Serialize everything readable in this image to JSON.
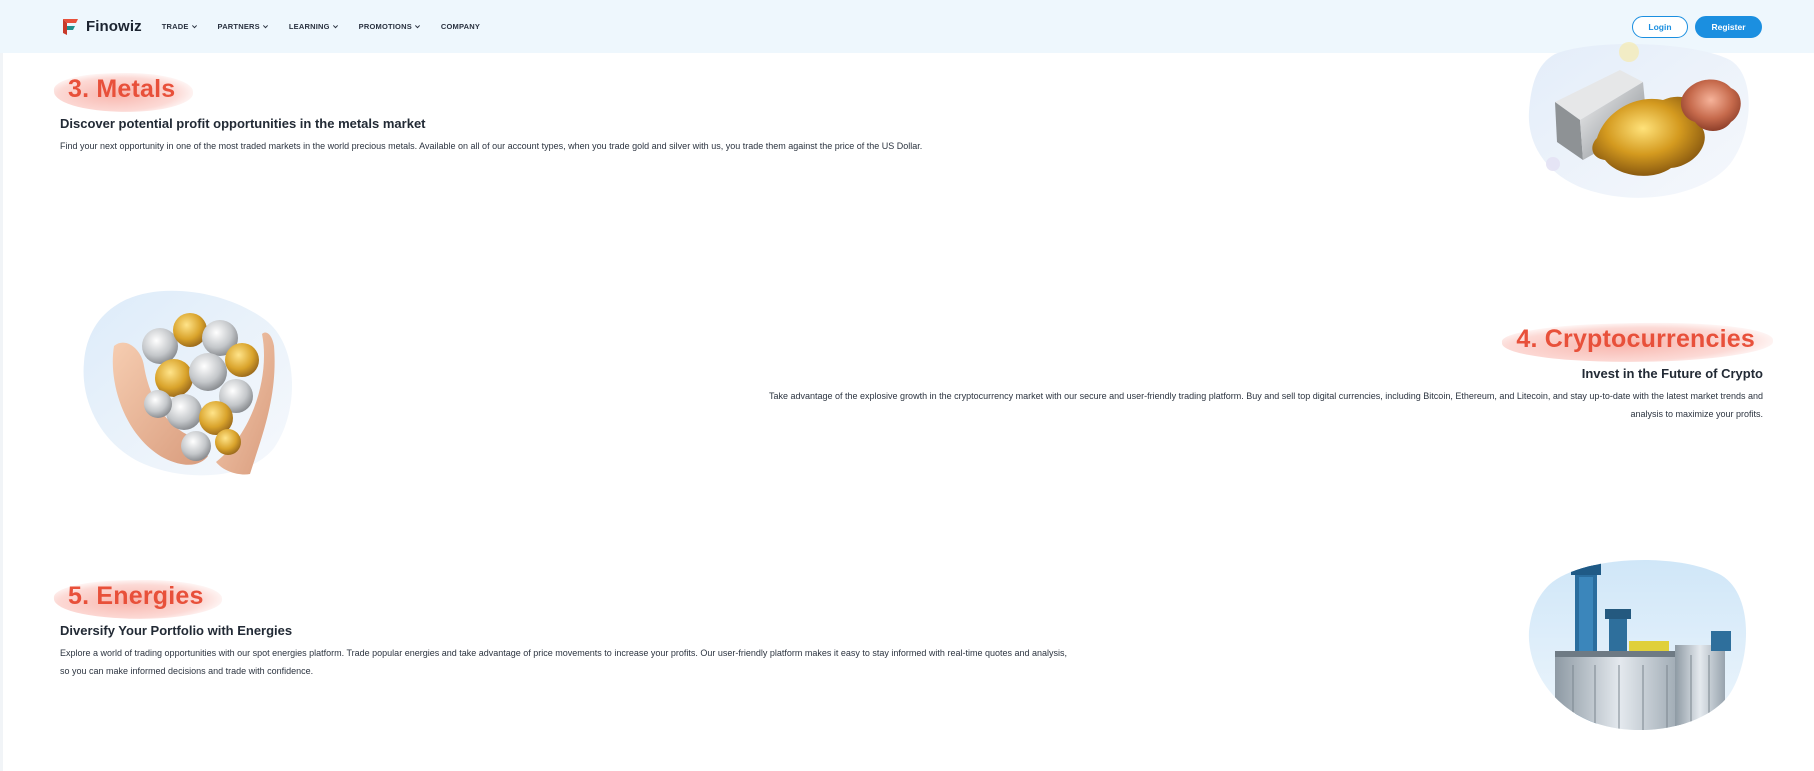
{
  "nav": {
    "brand": "Finowiz",
    "items": [
      {
        "label": "TRADE",
        "dropdown": true
      },
      {
        "label": "PARTNERS",
        "dropdown": true
      },
      {
        "label": "LEARNING",
        "dropdown": true
      },
      {
        "label": "PROMOTIONS",
        "dropdown": true
      },
      {
        "label": "COMPANY",
        "dropdown": false
      }
    ],
    "login_label": "Login",
    "register_label": "Register"
  },
  "sections": {
    "metals": {
      "heading": "3. Metals",
      "subheading": "Discover potential profit opportunities in the metals market",
      "description": "Find your next opportunity in one of the most traded markets in the world precious metals. Available on all of our account types, when you trade gold and silver with us, you trade them against the price of the US Dollar."
    },
    "crypto": {
      "heading": "4. Cryptocurrencies",
      "subheading": "Invest in the Future of Crypto",
      "description": "Take advantage of the explosive growth in the cryptocurrency market with our secure and user-friendly trading platform. Buy and sell top digital currencies, including Bitcoin, Ethereum, and Litecoin, and stay up-to-date with the latest market trends and analysis to maximize your profits."
    },
    "energy": {
      "heading": "5. Energies",
      "subheading": "Diversify Your Portfolio with Energies",
      "description": "Explore a world of trading opportunities with our spot energies platform. Trade popular energies and take advantage of price movements to increase your profits. Our user-friendly platform makes it easy to stay informed with real-time quotes and analysis, so you can make informed decisions and trade with confidence."
    }
  },
  "colors": {
    "accent": "#1b8fe0",
    "heading": "#e8503a",
    "nav_bg": "#eef7fd"
  },
  "icons": [
    "finowiz-logo-icon",
    "chevron-down-icon"
  ]
}
